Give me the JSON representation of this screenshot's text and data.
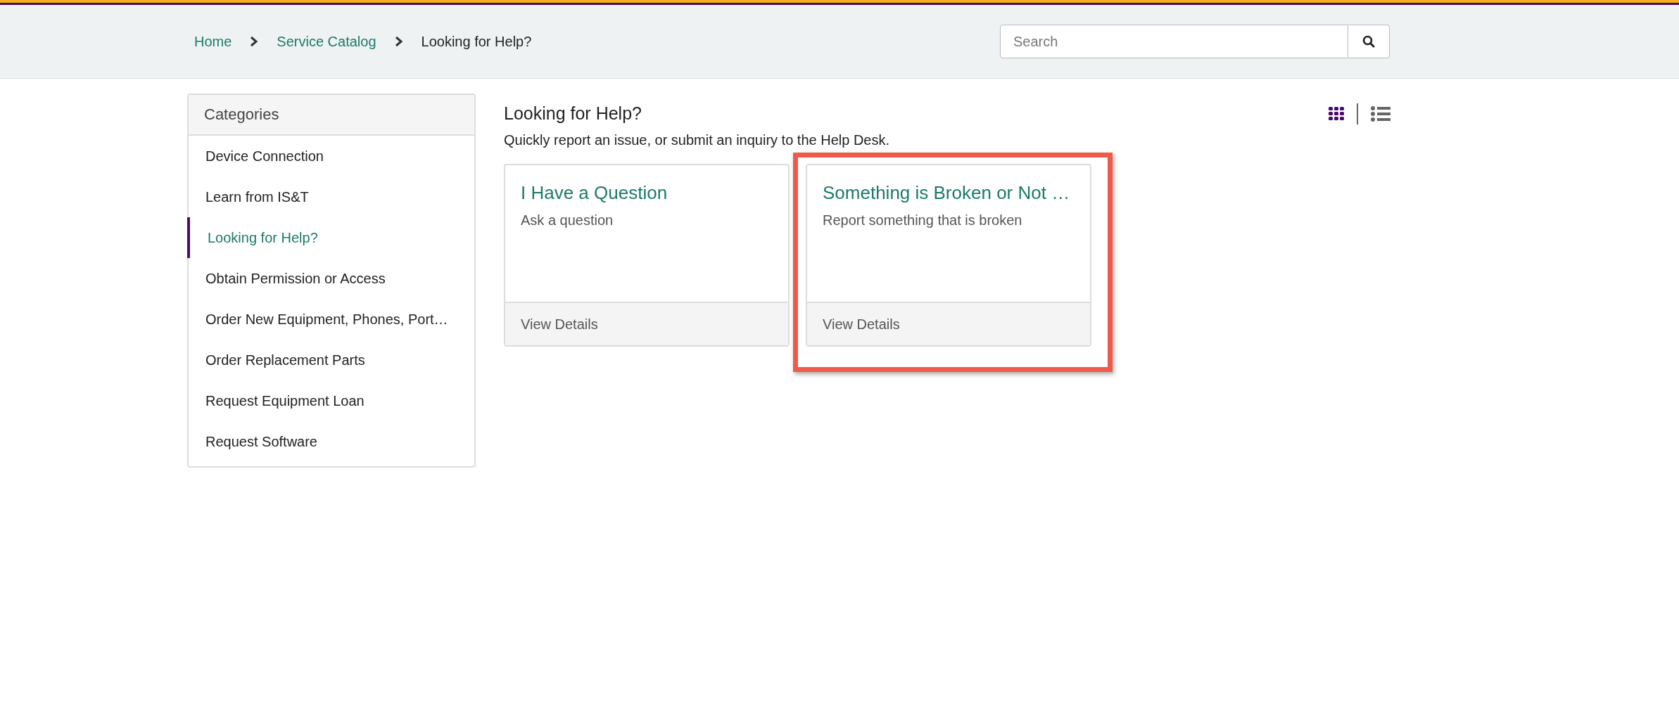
{
  "breadcrumb": [
    {
      "label": "Home",
      "link": true
    },
    {
      "label": "Service Catalog",
      "link": true
    },
    {
      "label": "Looking for Help?",
      "link": false
    }
  ],
  "search": {
    "placeholder": "Search"
  },
  "sidebar": {
    "title": "Categories",
    "items": [
      {
        "label": "Device Connection",
        "selected": false
      },
      {
        "label": "Learn from IS&T",
        "selected": false
      },
      {
        "label": "Looking for Help?",
        "selected": true
      },
      {
        "label": "Obtain Permission or Access",
        "selected": false
      },
      {
        "label": "Order New Equipment, Phones, Port…",
        "selected": false
      },
      {
        "label": "Order Replacement Parts",
        "selected": false
      },
      {
        "label": "Request Equipment Loan",
        "selected": false
      },
      {
        "label": "Request Software",
        "selected": false
      }
    ]
  },
  "main": {
    "title": "Looking for Help?",
    "description": "Quickly report an issue, or submit an inquiry to the Help Desk.",
    "view_toggles": [
      {
        "kind": "grid",
        "selected": true
      },
      {
        "kind": "list",
        "selected": false
      }
    ],
    "cards": [
      {
        "title": "I Have a Question",
        "description": "Ask a question",
        "footer": "View Details",
        "highlighted": false
      },
      {
        "title": "Something is Broken or Not …",
        "description": "Report something that is broken",
        "footer": "View Details",
        "highlighted": true
      }
    ]
  }
}
